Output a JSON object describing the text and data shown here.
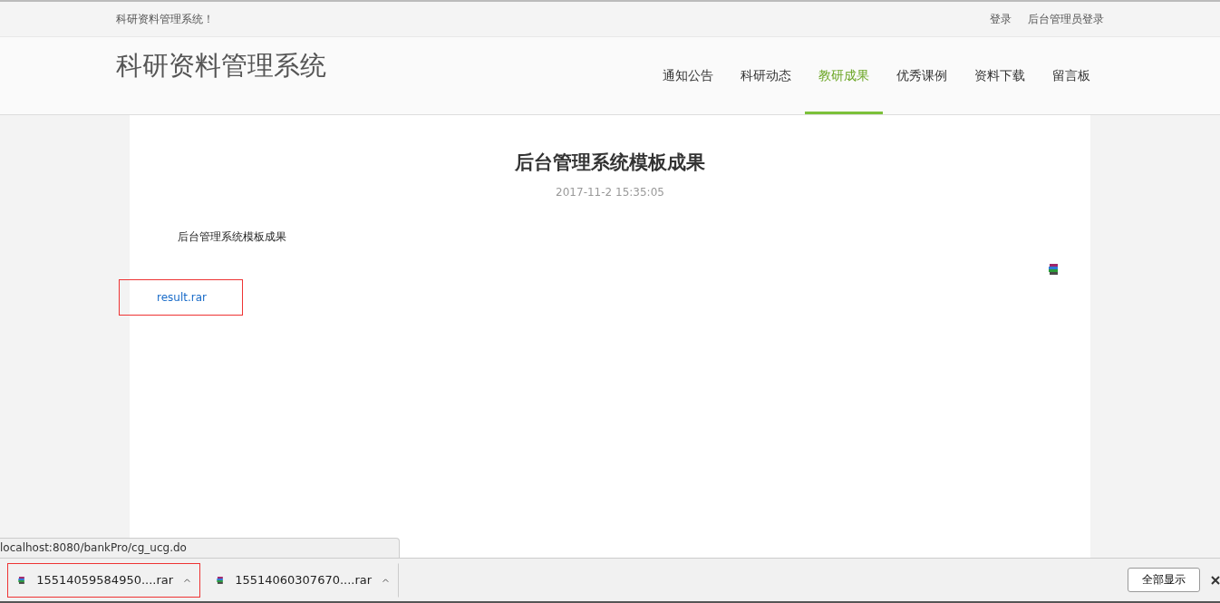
{
  "top_bar": {
    "welcome": "科研资料管理系统！",
    "links": [
      "登录",
      "后台管理员登录"
    ]
  },
  "header": {
    "logo": "科研资料管理系统",
    "nav": [
      {
        "label": "通知公告",
        "selected": false
      },
      {
        "label": "科研动态",
        "selected": false
      },
      {
        "label": "教研成果",
        "selected": true
      },
      {
        "label": "优秀课例",
        "selected": false
      },
      {
        "label": "资料下载",
        "selected": false
      },
      {
        "label": "留言板",
        "selected": false
      }
    ]
  },
  "article": {
    "title": "后台管理系统模板成果",
    "date": "2017-11-2 15:35:05",
    "body": "后台管理系统模板成果",
    "attachment": {
      "name": "result.rar",
      "highlighted": true
    }
  },
  "status_url": "localhost:8080/bankPro/cg_ucg.do",
  "downloads": {
    "items": [
      {
        "name": "15514059584950....rar",
        "highlighted": true
      },
      {
        "name": "15514060307670....rar",
        "highlighted": false
      }
    ],
    "show_all": "全部显示"
  }
}
